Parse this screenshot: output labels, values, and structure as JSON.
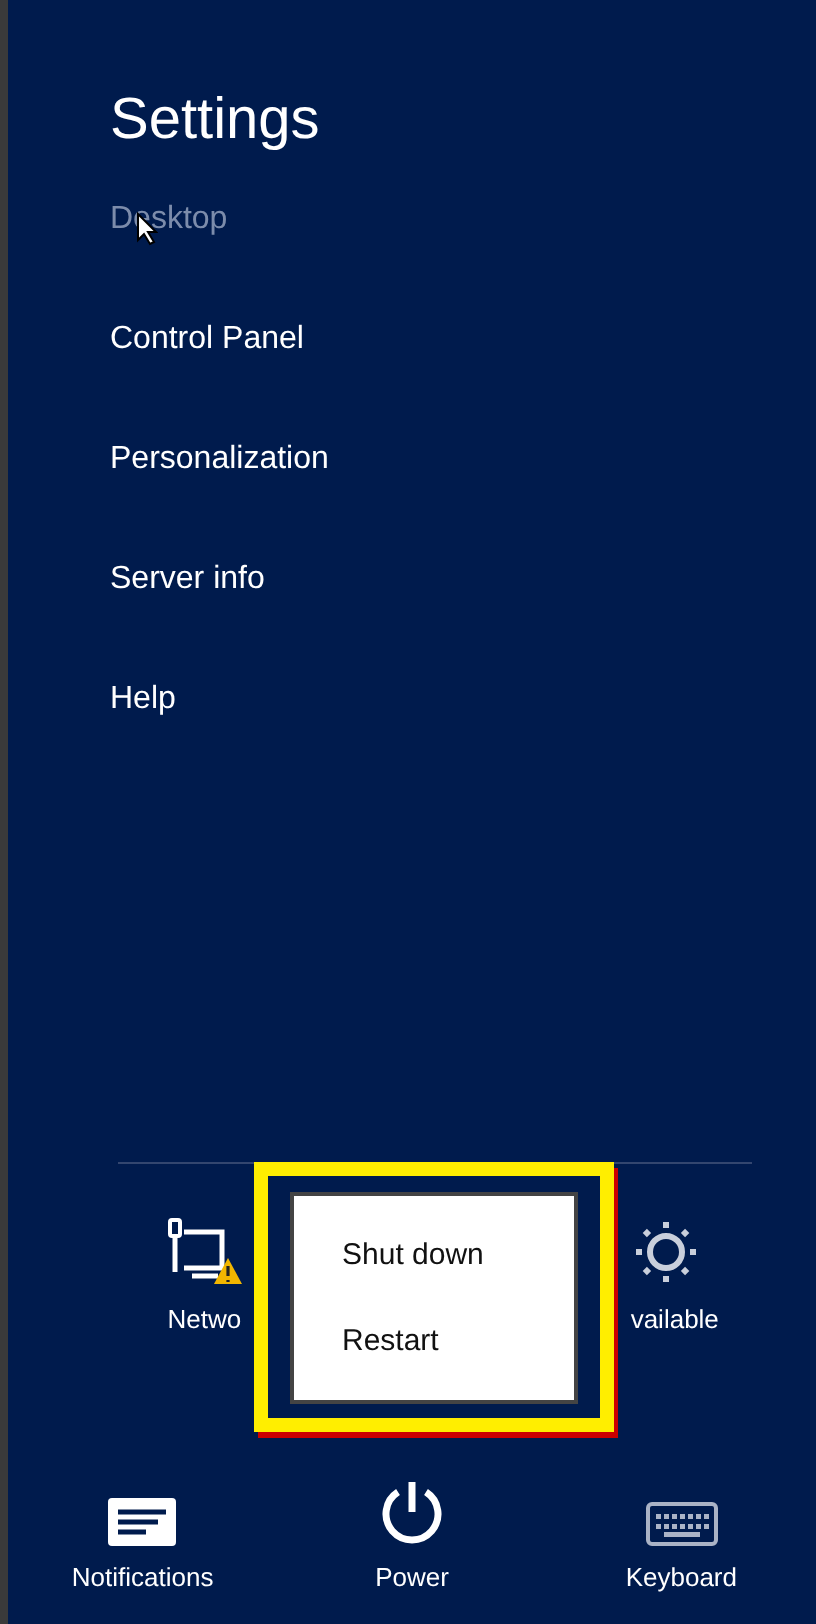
{
  "panel": {
    "title": "Settings",
    "items": [
      {
        "label": "Desktop",
        "hovered": true
      },
      {
        "label": "Control Panel",
        "hovered": false
      },
      {
        "label": "Personalization",
        "hovered": false
      },
      {
        "label": "Server info",
        "hovered": false
      },
      {
        "label": "Help",
        "hovered": false
      }
    ]
  },
  "top_tiles": [
    {
      "kind": "network",
      "label": "Netwo",
      "warning": true
    },
    {
      "kind": "brightness",
      "label": "vailable"
    }
  ],
  "bottom_tiles": [
    {
      "kind": "notifications",
      "label": "Notifications"
    },
    {
      "kind": "power",
      "label": "Power"
    },
    {
      "kind": "keyboard",
      "label": "Keyboard"
    }
  ],
  "power_menu": {
    "highlighted": true,
    "items": [
      {
        "label": "Shut down"
      },
      {
        "label": "Restart"
      }
    ]
  }
}
